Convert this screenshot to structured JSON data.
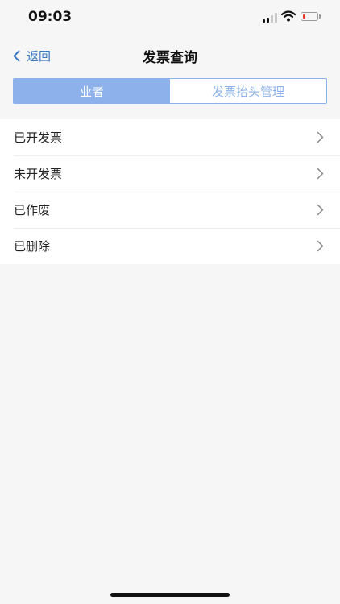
{
  "status": {
    "time": "09:03"
  },
  "nav": {
    "back_label": "返回",
    "title": "发票查询"
  },
  "tabs": [
    {
      "label": "业者",
      "active": true
    },
    {
      "label": "发票抬头管理",
      "active": false
    }
  ],
  "menu": [
    {
      "label": "已开发票"
    },
    {
      "label": "未开发票"
    },
    {
      "label": "已作废"
    },
    {
      "label": "已删除"
    }
  ],
  "colors": {
    "accent": "#8db1ea",
    "link": "#3a78c4",
    "background": "#f6f6f6",
    "battery_low": "#e53935"
  },
  "icons": [
    "cellular-signal-icon",
    "wifi-icon",
    "battery-icon",
    "chevron-left-icon",
    "chevron-right-icon"
  ]
}
